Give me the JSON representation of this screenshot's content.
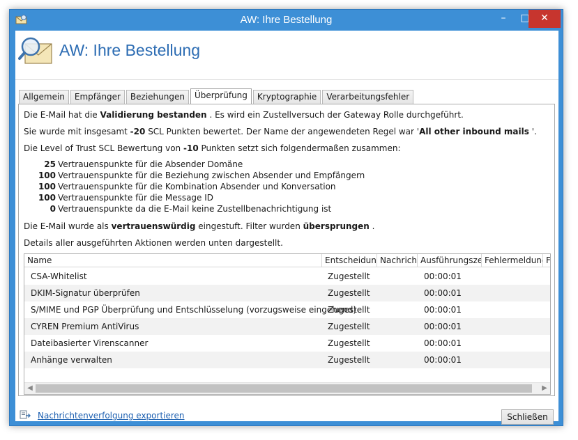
{
  "window": {
    "title": "AW: Ihre Bestellung",
    "minimize_glyph": "–",
    "maximize_glyph": "□",
    "close_glyph": "✕",
    "accent_color": "#3d8fd6",
    "close_color": "#c7352e"
  },
  "header": {
    "title": "AW: Ihre Bestellung",
    "icon": "envelope-magnifier-icon",
    "title_color": "#2c6cb3"
  },
  "tabs": [
    {
      "label": "Allgemein",
      "active": false
    },
    {
      "label": "Empfänger",
      "active": false
    },
    {
      "label": "Beziehungen",
      "active": false
    },
    {
      "label": "Überprüfung",
      "active": true
    },
    {
      "label": "Kryptographie",
      "active": false
    },
    {
      "label": "Verarbeitungsfehler",
      "active": false
    }
  ],
  "summary": {
    "line1_pre": "Die E-Mail hat die",
    "line1_bold": "Validierung bestanden",
    "line1_post": ". Es wird ein Zustellversuch der Gateway Rolle durchgeführt.",
    "line2_pre": "Sie wurde mit insgesamt",
    "line2_bold": "-20",
    "line2_mid": "SCL Punkten bewertet.   Der Name der angewendeten Regel war '",
    "line2_rule": "All other inbound mails",
    "line2_post": "'.",
    "line3_pre": "Die Level of Trust SCL Bewertung von",
    "line3_bold": "-10",
    "line3_post": "Punkten setzt sich folgendermaßen zusammen:",
    "trust_items": [
      {
        "points": "25",
        "text": "Vertrauenspunkte für die Absender Domäne"
      },
      {
        "points": "100",
        "text": "Vertrauenspunkte für die Beziehung zwischen Absender und Empfängern"
      },
      {
        "points": "100",
        "text": "Vertrauenspunkte für die Kombination Absender und Konversation"
      },
      {
        "points": "100",
        "text": "Vertrauenspunkte für die Message ID"
      },
      {
        "points": "0",
        "text": "Vertrauenspunkte da die E-Mail keine Zustellbenachrichtigung ist"
      }
    ],
    "line4_pre": "Die E-Mail wurde als",
    "line4_bold1": "vertrauenswürdig",
    "line4_mid": "eingestuft. Filter wurden",
    "line4_bold2": "übersprungen",
    "line4_post": ".",
    "line5": "Details aller ausgeführten Aktionen werden unten dargestellt."
  },
  "grid": {
    "columns": [
      "Name",
      "Entscheidung",
      "Nachricht",
      "Ausführungszeit",
      "Fehlermeldung",
      "F"
    ],
    "rows": [
      {
        "name": "CSA-Whitelist",
        "decision": "Zugestellt",
        "time": "00:00:01"
      },
      {
        "name": "DKIM-Signatur überprüfen",
        "decision": "Zugestellt",
        "time": "00:00:01"
      },
      {
        "name": "S/MIME und PGP Überprüfung und Entschlüsselung (vorzugsweise eingehend)",
        "decision": "Zugestellt",
        "time": "00:00:01"
      },
      {
        "name": "CYREN Premium AntiVirus",
        "decision": "Zugestellt",
        "time": "00:00:01"
      },
      {
        "name": "Dateibasierter Virenscanner",
        "decision": "Zugestellt",
        "time": "00:00:01"
      },
      {
        "name": "Anhänge verwalten",
        "decision": "Zugestellt",
        "time": "00:00:01"
      }
    ],
    "scroll_left": "◀",
    "scroll_right": "▶"
  },
  "footer": {
    "export_link": "Nachrichtenverfolgung exportieren",
    "export_icon": "export-document-icon",
    "close_label": "Schließen",
    "link_color": "#1c5fb0"
  }
}
